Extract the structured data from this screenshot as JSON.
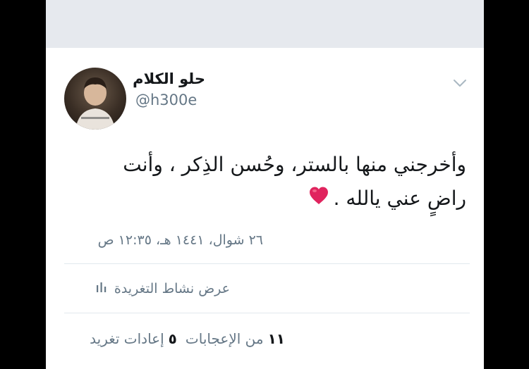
{
  "tweet": {
    "author": {
      "display_name": "حلو الكلام",
      "handle": "@h300e"
    },
    "text_line1": "وأخرجني منها بالستر، وحُسن الذِكر ، وأنت",
    "text_line2": "راضٍ عني يالله .",
    "timestamp": "٢٦ شوال، ١٤٤١ هـ، ١٢:٣٥ ص",
    "activity_label": "عرض نشاط التغريدة",
    "stats": {
      "likes_count": "١١",
      "likes_label": "من الإعجابات",
      "retweets_count": "٥",
      "retweets_label": "إعادات تغريد"
    }
  },
  "colors": {
    "background": "#ffffff",
    "top_bar": "#e6e9ee",
    "text_primary": "#14171a",
    "text_secondary": "#657786",
    "heart": "#e0245e",
    "divider": "#e1e8ed"
  },
  "icons": {
    "menu": "chevron-down-icon",
    "activity": "bar-chart-icon",
    "heart": "heart-emoji-icon"
  }
}
